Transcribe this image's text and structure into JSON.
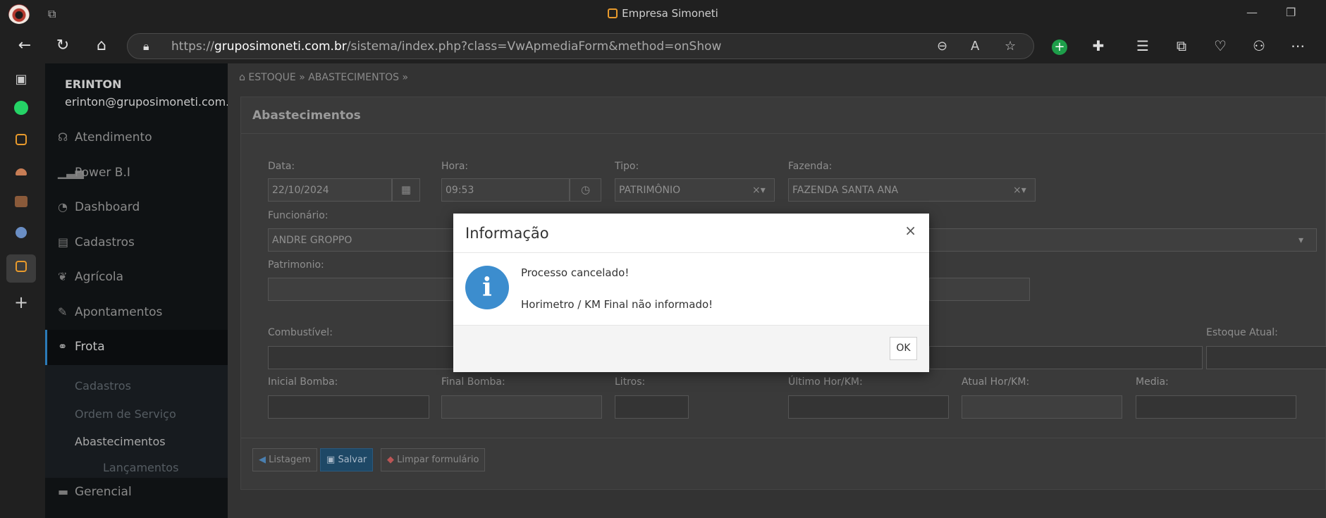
{
  "browser": {
    "window_title": "Empresa Simoneti",
    "url_host": "gruposimoneti.com.br",
    "url_prefix": "https://",
    "url_path": "/sistema/index.php?class=VwApmediaForm&method=onShow"
  },
  "user": {
    "name": "ERINTON",
    "email": "erinton@gruposimoneti.com.br"
  },
  "menu": {
    "atendimento": "Atendimento",
    "powerbi": "Power B.I",
    "dashboard": "Dashboard",
    "cadastros": "Cadastros",
    "agricola": "Agrícola",
    "apontamentos": "Apontamentos",
    "frota": "Frota",
    "gerencial": "Gerencial",
    "frota_sub": {
      "cadastros": "Cadastros",
      "ordem": "Ordem de Serviço",
      "abastecimentos": "Abastecimentos",
      "lancamentos": "Lançamentos"
    }
  },
  "breadcrumb": {
    "level1": "ESTOQUE",
    "level2": "ABASTECIMENTOS"
  },
  "form": {
    "title": "Abastecimentos",
    "data_label": "Data:",
    "data_value": "22/10/2024",
    "hora_label": "Hora:",
    "hora_value": "09:53",
    "tipo_label": "Tipo:",
    "tipo_value": "PATRIMÔNIO",
    "fazenda_label": "Fazenda:",
    "fazenda_value": "FAZENDA SANTA ANA",
    "funcionario_label": "Funcionário:",
    "funcionario_value": "ANDRE GROPPO",
    "patrimonio_label": "Patrimonio:",
    "combustivel_label": "Combustível:",
    "estoque_label": "Estoque Atual:",
    "inicial_label": "Inicial Bomba:",
    "final_label": "Final Bomba:",
    "litros_label": "Litros:",
    "ultimo_label": "Último Hor/KM:",
    "atual_label": "Atual Hor/KM:",
    "media_label": "Media:",
    "btn_listagem": "Listagem",
    "btn_salvar": "Salvar",
    "btn_limpar": "Limpar formulário"
  },
  "modal": {
    "title": "Informação",
    "line1": "Processo cancelado!",
    "line2": "Horimetro / KM Final não informado!",
    "ok": "OK"
  }
}
